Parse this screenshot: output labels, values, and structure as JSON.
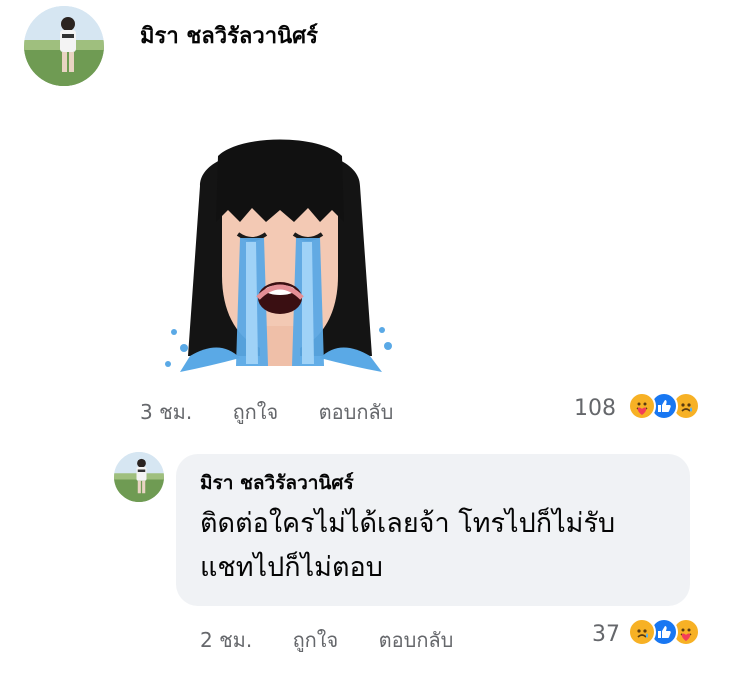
{
  "comment": {
    "author": "มิรา ชลวิรัลวานิศร์",
    "time": "3 ชม.",
    "like_label": "ถูกใจ",
    "reply_label": "ตอบกลับ",
    "reaction_count": "108",
    "reactions": [
      "care-icon",
      "like-icon",
      "sad-icon"
    ],
    "sticker": "crying-girl-sticker"
  },
  "reply": {
    "author": "มิรา ชลวิรัลวานิศร์",
    "text": "ติดต่อใครไม่ได้เลยจ้า โทรไปก็ไม่รับ\nแชทไปก็ไม่ตอบ",
    "time": "2 ชม.",
    "like_label": "ถูกใจ",
    "reply_label": "ตอบกลับ",
    "reaction_count": "37",
    "reactions": [
      "sad-icon",
      "like-icon",
      "care-icon"
    ]
  },
  "colors": {
    "bubble": "#f0f2f5",
    "meta_text": "#65676b",
    "like_blue": "#1877f2",
    "emoji_yellow": "#f7b125",
    "care_red": "#f33e58"
  }
}
